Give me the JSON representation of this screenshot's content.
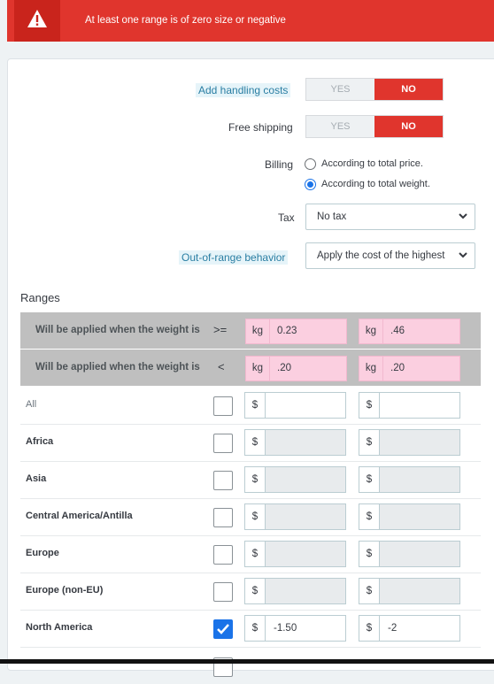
{
  "alert": {
    "icon": "warning-triangle-icon",
    "message": "At least one range is of zero size or negative",
    "color": "#e0352d"
  },
  "form": {
    "handling": {
      "label": "Add handling costs",
      "yes": "YES",
      "no": "NO",
      "selected": "NO"
    },
    "free_shipping": {
      "label": "Free shipping",
      "yes": "YES",
      "no": "NO",
      "selected": "NO"
    },
    "billing": {
      "label": "Billing",
      "options": [
        "According to total price.",
        "According to total weight."
      ],
      "selected": "According to total weight."
    },
    "tax": {
      "label": "Tax",
      "value": "No tax"
    },
    "out_of_range": {
      "label": "Out-of-range behavior",
      "value": "Apply the cost of the highest"
    }
  },
  "ranges": {
    "heading": "Ranges",
    "ge_row": {
      "label": "Will be applied when the weight is",
      "operator": ">=",
      "unit": "kg",
      "values": [
        "0.23",
        ".46"
      ]
    },
    "lt_row": {
      "label": "Will be applied when the weight is",
      "operator": "<",
      "unit": "kg",
      "values": [
        ".20",
        ".20"
      ]
    },
    "currency": "$",
    "zones": [
      {
        "name": "All",
        "checked": false,
        "values": [
          "",
          ""
        ]
      },
      {
        "name": "Africa",
        "checked": false,
        "values": [
          "",
          ""
        ]
      },
      {
        "name": "Asia",
        "checked": false,
        "values": [
          "",
          ""
        ]
      },
      {
        "name": "Central America/Antilla",
        "checked": false,
        "values": [
          "",
          ""
        ]
      },
      {
        "name": "Europe",
        "checked": false,
        "values": [
          "",
          ""
        ]
      },
      {
        "name": "Europe (non-EU)",
        "checked": false,
        "values": [
          "",
          ""
        ]
      },
      {
        "name": "North America",
        "checked": true,
        "values": [
          "-1.50",
          "-2"
        ]
      }
    ]
  }
}
